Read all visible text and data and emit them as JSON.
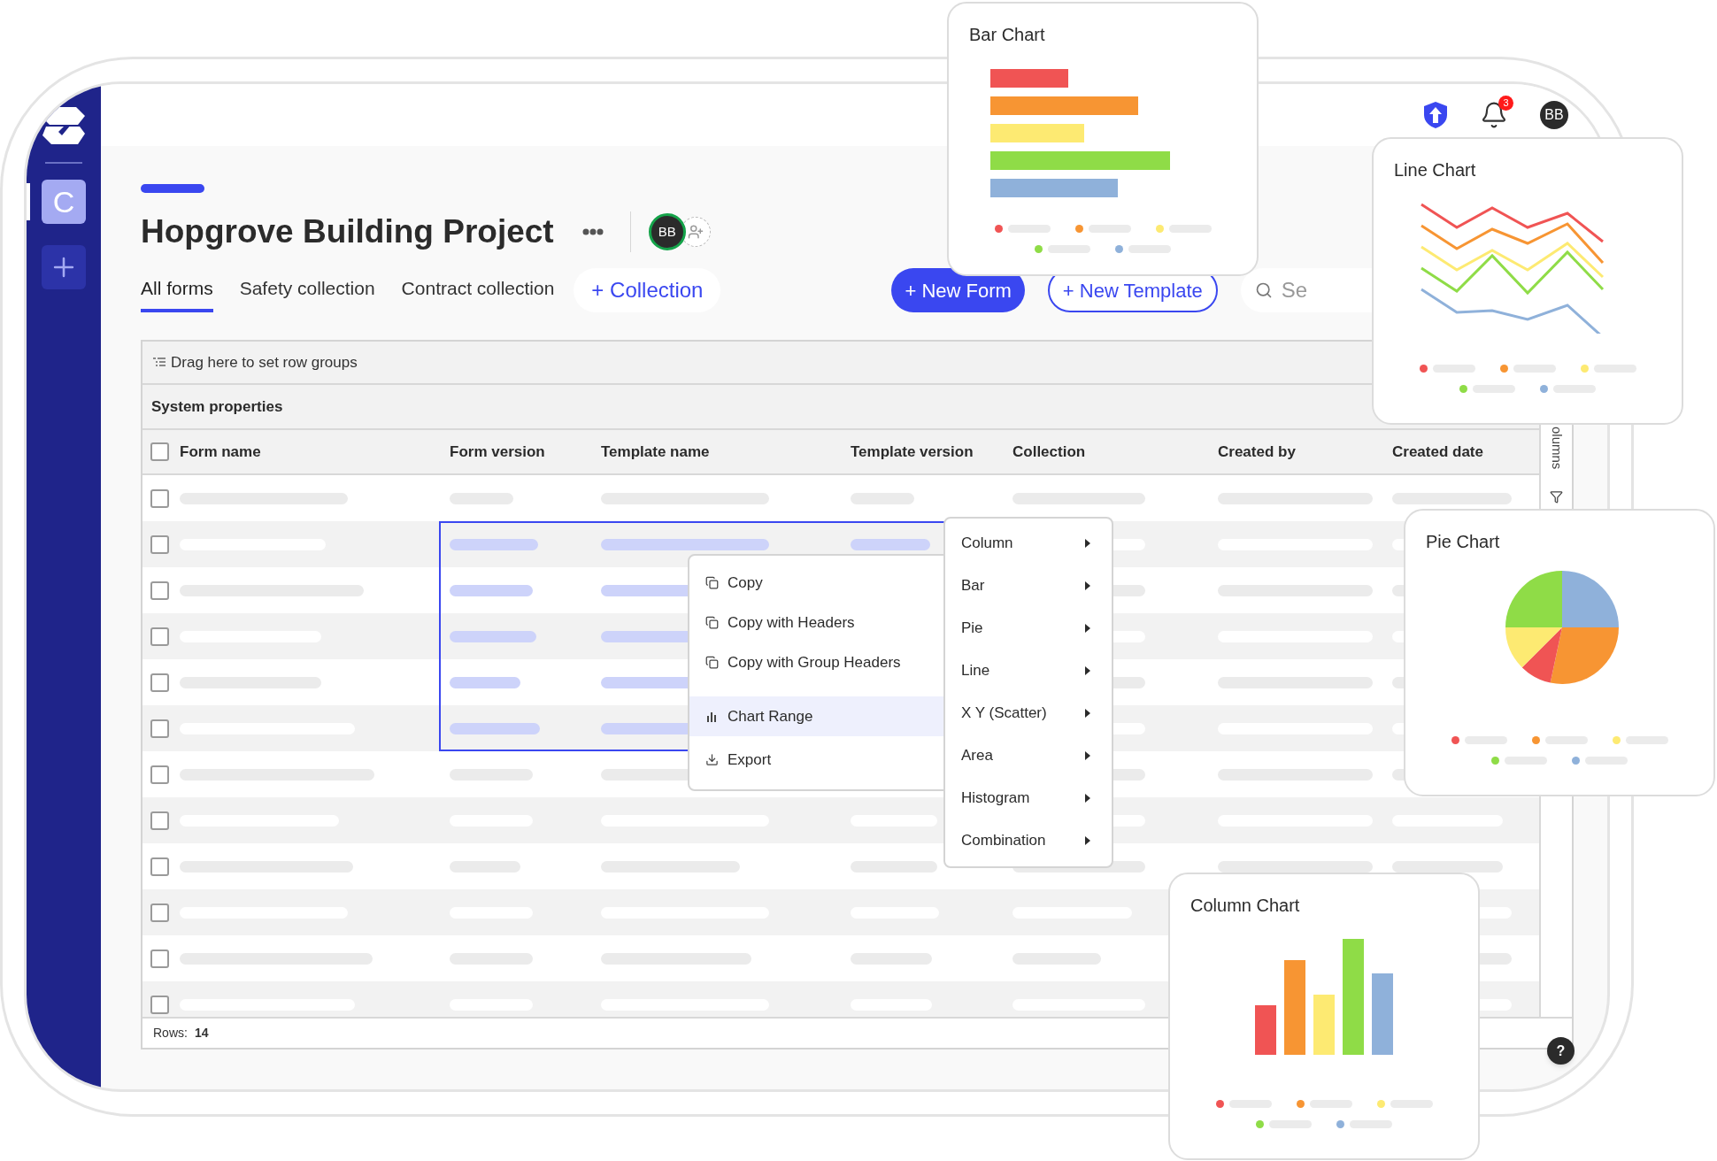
{
  "sidebar": {
    "workspace": {
      "label": "C",
      "selected": true
    }
  },
  "header": {
    "notifications": "3",
    "avatar": "BB"
  },
  "project": {
    "title": "Hopgrove Building Project",
    "member_avatar": "BB"
  },
  "tabs": [
    {
      "label": "All forms",
      "selected": true
    },
    {
      "label": "Safety collection",
      "selected": false
    },
    {
      "label": "Contract collection",
      "selected": false
    }
  ],
  "add_collection": "+ Collection",
  "buttons": [
    {
      "label": "+ New Form",
      "kind": "primary"
    },
    {
      "label": "+ New Template",
      "kind": "outline"
    }
  ],
  "search": {
    "placeholder": "Se"
  },
  "grid": {
    "group_bar": "Drag here to set row groups",
    "group_header": "System properties",
    "header_checked": false,
    "columns": [
      "Form name",
      "Form version",
      "Template name",
      "Template version",
      "Collection",
      "Created by",
      "Created date"
    ],
    "rows": [
      {
        "selected": false,
        "checked": false
      },
      {
        "selected": true,
        "checked": false
      },
      {
        "selected": true,
        "checked": false
      },
      {
        "selected": true,
        "checked": false
      },
      {
        "selected": true,
        "checked": false
      },
      {
        "selected": true,
        "checked": false
      },
      {
        "selected": false,
        "checked": false
      },
      {
        "selected": false,
        "checked": false
      },
      {
        "selected": false,
        "checked": false
      },
      {
        "selected": false,
        "checked": false
      },
      {
        "selected": false,
        "checked": false
      },
      {
        "selected": false,
        "checked": false
      }
    ],
    "footer_label": "Rows:",
    "row_count": "14",
    "side_tab": "olumns"
  },
  "context_menu": {
    "items": [
      {
        "label": "Copy",
        "kind": "copy",
        "selected": false
      },
      {
        "label": "Copy with Headers",
        "kind": "copy",
        "selected": false
      },
      {
        "label": "Copy with Group Headers",
        "kind": "copy",
        "selected": false
      },
      {
        "label": "Chart Range",
        "kind": "chart",
        "selected": true
      },
      {
        "label": "Export",
        "kind": "export",
        "selected": false
      }
    ]
  },
  "chart_submenu": {
    "items": [
      "Column",
      "Bar",
      "Pie",
      "Line",
      "X Y (Scatter)",
      "Area",
      "Histogram",
      "Combination"
    ]
  },
  "chart_cards": [
    {
      "title": "Bar Chart",
      "kind": "bar",
      "legend": [
        {
          "color": "#f05454"
        },
        {
          "color": "#f79533"
        },
        {
          "color": "#fdea72"
        },
        {
          "color": "#8fdc47"
        },
        {
          "color": "#8fb1da"
        }
      ]
    },
    {
      "title": "Line Chart",
      "kind": "line",
      "legend": [
        {
          "color": "#f05454"
        },
        {
          "color": "#f79533"
        },
        {
          "color": "#fdea72"
        },
        {
          "color": "#8fdc47"
        },
        {
          "color": "#8fb1da"
        }
      ]
    },
    {
      "title": "Pie Chart",
      "kind": "pie",
      "legend": [
        {
          "color": "#f05454"
        },
        {
          "color": "#f79533"
        },
        {
          "color": "#fdea72"
        },
        {
          "color": "#8fdc47"
        },
        {
          "color": "#8fb1da"
        }
      ]
    },
    {
      "title": "Column Chart",
      "kind": "column",
      "legend": [
        {
          "color": "#f05454"
        },
        {
          "color": "#f79533"
        },
        {
          "color": "#fdea72"
        },
        {
          "color": "#8fdc47"
        },
        {
          "color": "#8fb1da"
        }
      ]
    }
  ],
  "help": "?"
}
